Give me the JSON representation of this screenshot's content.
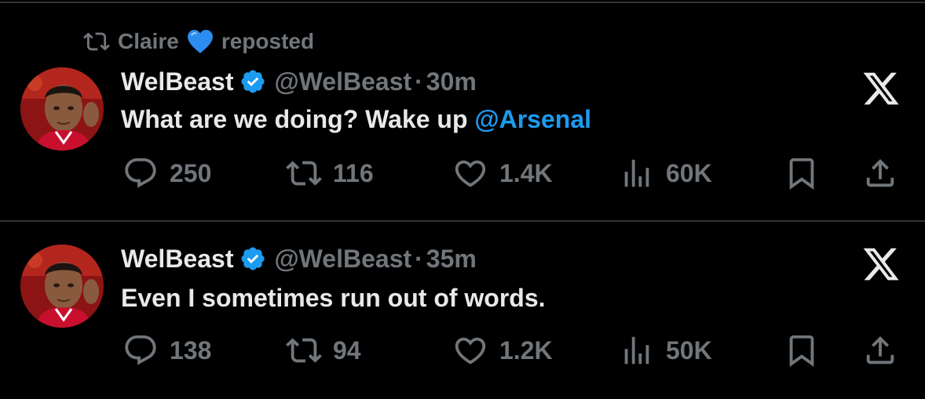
{
  "repost": {
    "user": "Claire",
    "label": "reposted"
  },
  "tweets": [
    {
      "name": "WelBeast",
      "handle": "@WelBeast",
      "separator": "·",
      "time": "30m",
      "text": "What are we doing? Wake up ",
      "mention": "@Arsenal",
      "replies": "250",
      "reposts": "116",
      "likes": "1.4K",
      "views": "60K"
    },
    {
      "name": "WelBeast",
      "handle": "@WelBeast",
      "separator": "·",
      "time": "35m",
      "text": "Even I sometimes run out of words.",
      "mention": "",
      "replies": "138",
      "reposts": "94",
      "likes": "1.2K",
      "views": "50K"
    }
  ],
  "colors": {
    "background": "#000000",
    "text": "#e7e9ea",
    "muted": "#71767b",
    "link": "#1d9bf0",
    "divider": "#2f3336"
  },
  "icons": [
    "repost-icon",
    "blue-heart-emoji",
    "verified-badge-icon",
    "x-logo-icon",
    "reply-icon",
    "like-icon",
    "views-icon",
    "bookmark-icon",
    "share-icon"
  ]
}
